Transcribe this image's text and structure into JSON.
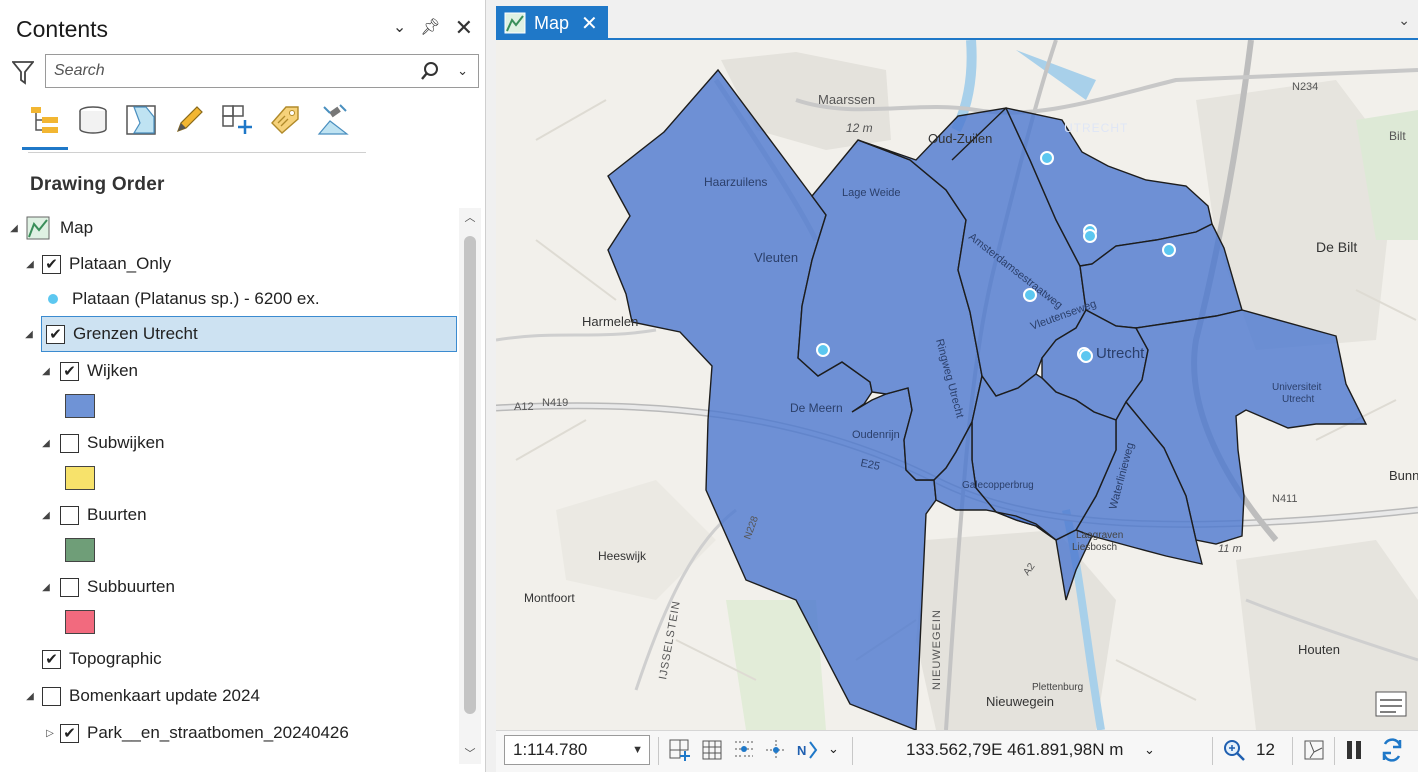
{
  "contents": {
    "title": "Contents",
    "search_placeholder": "Search",
    "section_title": "Drawing Order",
    "tools": [
      "list-by-drawing-order-icon",
      "list-by-data-source-icon",
      "list-by-selection-icon",
      "list-by-editing-icon",
      "list-by-snapping-icon",
      "list-by-labeling-icon",
      "list-by-perspective-imagery-icon"
    ],
    "layers": {
      "map": "Map",
      "plataan_only": "Plataan_Only",
      "plataan_symbol": "Plataan (Platanus sp.) - 6200 ex.",
      "grenzen": "Grenzen Utrecht",
      "wijken": "Wijken",
      "subwijken": "Subwijken",
      "buurten": "Buurten",
      "subbuurten": "Subbuurten",
      "topographic": "Topographic",
      "bomenkaart": "Bomenkaart update 2024",
      "park": "Park__en_straatbomen_20240426"
    },
    "colors": {
      "wijken": "#6f93d6",
      "subwijken": "#f7e26b",
      "buurten": "#6f9e78",
      "subbuurten": "#f26a7e",
      "plataan_point": "#5cc7f0"
    }
  },
  "map_view": {
    "tab_label": "Map",
    "basemap_labels": {
      "maarssen": "Maarssen",
      "oud_zuilen": "Oud-Zuilen",
      "haarzuilens": "Haarzuilens",
      "lage_weide": "Lage Weide",
      "vleuten": "Vleuten",
      "harmelen": "Harmelen",
      "de_meern": "De Meern",
      "oudenrijn": "Oudenrijn",
      "utrecht": "Utrecht",
      "utrecht_upper": "UTRECHT",
      "de_bilt": "De Bilt",
      "universiteit": "Universiteit Utrecht",
      "bunnik": "Bunnik",
      "heeswijk": "Heeswijk",
      "montfoort": "Montfoort",
      "ijsselstein": "IJSSELSTEIN",
      "nieuwegein_upper": "NIEUWEGEIN",
      "nieuwegein": "Nieuwegein",
      "houten": "Houten",
      "laagraven": "Laagraven",
      "liesbosch": "Liesbosch",
      "plettenburg": "Plettenburg",
      "a12": "A12",
      "n419": "N419",
      "n234": "N234",
      "n411": "N411",
      "n228": "N228",
      "e25": "E25",
      "bilt_short": "Bilt",
      "amsterdamsestraatweg": "Amsterdamsestraatweg",
      "ringweg": "Ringweg Utrecht",
      "weg_der_verenigde": "Vleutenseweg",
      "waterlinieweg": "Waterlinieweg",
      "a2": "A2",
      "twelve_m": "12 m",
      "eleven_m": "11 m",
      "galecopperbrug": "Galecopperbrug",
      "bilt_2": "Bilt"
    }
  },
  "statusbar": {
    "scale": "1:114.780",
    "coordinates": "133.562,79E 461.891,98N m",
    "selected_count": "12"
  }
}
